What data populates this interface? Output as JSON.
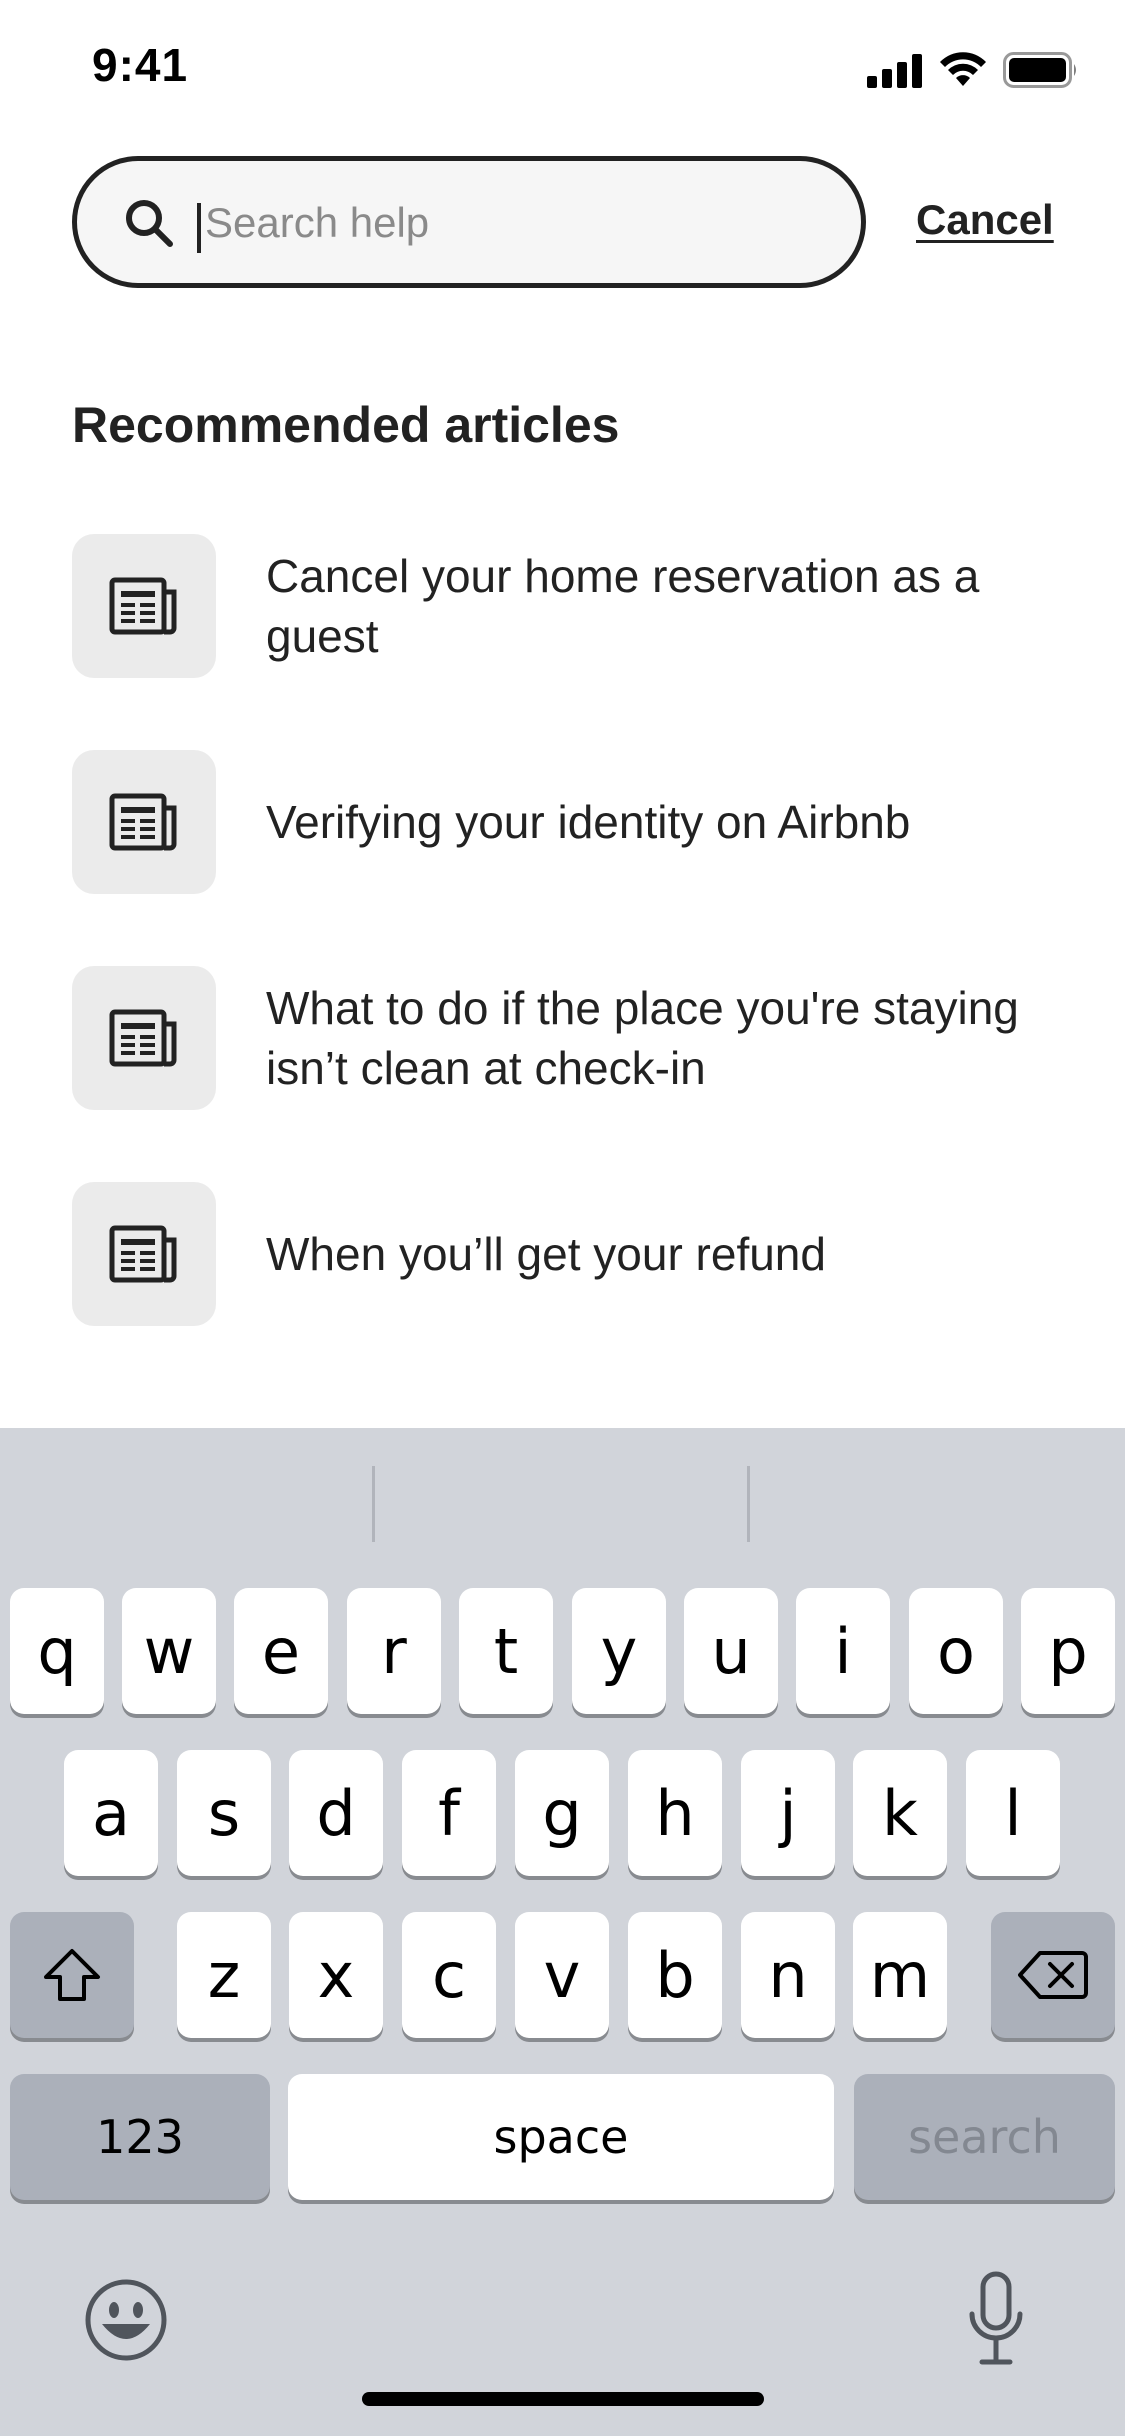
{
  "status_bar": {
    "time": "9:41"
  },
  "search": {
    "placeholder": "Search help",
    "cancel_label": "Cancel"
  },
  "recommended": {
    "title": "Recommended articles",
    "articles": [
      {
        "label": "Cancel your home reservation as a guest",
        "icon": "article-icon"
      },
      {
        "label": "Verifying your identity on Airbnb",
        "icon": "article-icon"
      },
      {
        "label": "What to do if the place you're staying isn’t clean at check-in",
        "icon": "article-icon"
      },
      {
        "label": "When you’ll get your refund",
        "icon": "article-icon"
      }
    ]
  },
  "keyboard": {
    "row1": [
      "q",
      "w",
      "e",
      "r",
      "t",
      "y",
      "u",
      "i",
      "o",
      "p"
    ],
    "row2": [
      "a",
      "s",
      "d",
      "f",
      "g",
      "h",
      "j",
      "k",
      "l"
    ],
    "row3": [
      "z",
      "x",
      "c",
      "v",
      "b",
      "n",
      "m"
    ],
    "numbers_label": "123",
    "space_label": "space",
    "search_label": "search",
    "shift_icon": "shift-icon",
    "delete_icon": "delete-icon",
    "emoji_icon": "emoji-icon",
    "mic_icon": "microphone-icon"
  },
  "colors": {
    "text": "#222222",
    "thumb_bg": "#ebebeb",
    "keyboard_bg": "#d1d4da",
    "dark_key": "#abb0ba"
  }
}
